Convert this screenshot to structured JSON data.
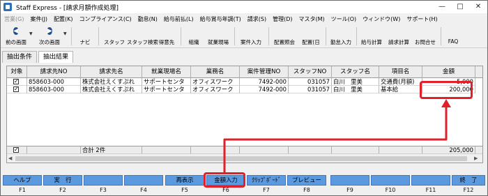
{
  "window": {
    "title": "Staff Express - [請求月額作成処理]",
    "controls": [
      "—",
      "□",
      "✕"
    ]
  },
  "menu": [
    {
      "label": "営業(G)",
      "disabled": true
    },
    {
      "label": "案件(J)",
      "disabled": false
    },
    {
      "label": "配置(K)",
      "disabled": false
    },
    {
      "label": "コンプライアンス(C)",
      "disabled": false
    },
    {
      "label": "勤怠(N)",
      "disabled": false
    },
    {
      "label": "給与前払(L)",
      "disabled": false
    },
    {
      "label": "給与賞与年調(T)",
      "disabled": false
    },
    {
      "label": "請求(S)",
      "disabled": false
    },
    {
      "label": "管理(D)",
      "disabled": false
    },
    {
      "label": "マスタ(M)",
      "disabled": false
    },
    {
      "label": "ツール(O)",
      "disabled": false
    },
    {
      "label": "ウィンドウ(W)",
      "disabled": false
    },
    {
      "label": "サポート(H)",
      "disabled": false
    }
  ],
  "toolbar": {
    "back": "前の画面",
    "forward": "次の画面",
    "navi": "ナビ",
    "staff": "スタッフ",
    "staff_search": "スタッフ検索",
    "client": "得意先",
    "org": "組織",
    "site": "就業現場",
    "job_entry": "案件入力",
    "assign_view": "配置照会",
    "assign_day": "配置(日",
    "attendance": "勤怠入力",
    "payroll": "給与計算",
    "billing": "請求計算",
    "contact": "お問合せ",
    "faq": "FAQ"
  },
  "tabs": [
    "抽出条件",
    "抽出結果"
  ],
  "table": {
    "columns": [
      "対象",
      "請求先NO",
      "請求先名",
      "就業現場名",
      "業務名",
      "案件管理NO",
      "スタッフNO",
      "スタッフ名",
      "項目名",
      "金額"
    ],
    "rows": [
      [
        "858603-000",
        "株式会社えくすぷれ",
        "サポートセンタ",
        "オフィスワーク",
        "7492-000",
        "031057",
        "白川　里美",
        "交通費(月額)",
        "5,000"
      ],
      [
        "858603-000",
        "株式会社えくすぷれ",
        "サポートセンタ",
        "オフィスワーク",
        "7492-000",
        "031057",
        "白川　里美",
        "基本給",
        "200,000"
      ]
    ],
    "total_label": "合計 2件",
    "total_amount": "205,000"
  },
  "fkeys": [
    {
      "key": "F1",
      "label": "ヘルプ"
    },
    {
      "key": "F2",
      "label": "実　行"
    },
    {
      "key": "F3",
      "label": ""
    },
    {
      "key": "F4",
      "label": ""
    },
    {
      "key": "F5",
      "label": "再表示"
    },
    {
      "key": "F6",
      "label": "金額入力"
    },
    {
      "key": "F7",
      "label": "ｸﾘｯﾌﾟﾎﾞｰﾄﾞ"
    },
    {
      "key": "F8",
      "label": "プレビュー"
    },
    {
      "key": "F9",
      "label": ""
    },
    {
      "key": "F10",
      "label": ""
    },
    {
      "key": "F11",
      "label": ""
    },
    {
      "key": "F12",
      "label": "終　了"
    }
  ],
  "colors": {
    "fkey_blue": "#5c9ae0",
    "highlight_red": "#e0202a"
  }
}
